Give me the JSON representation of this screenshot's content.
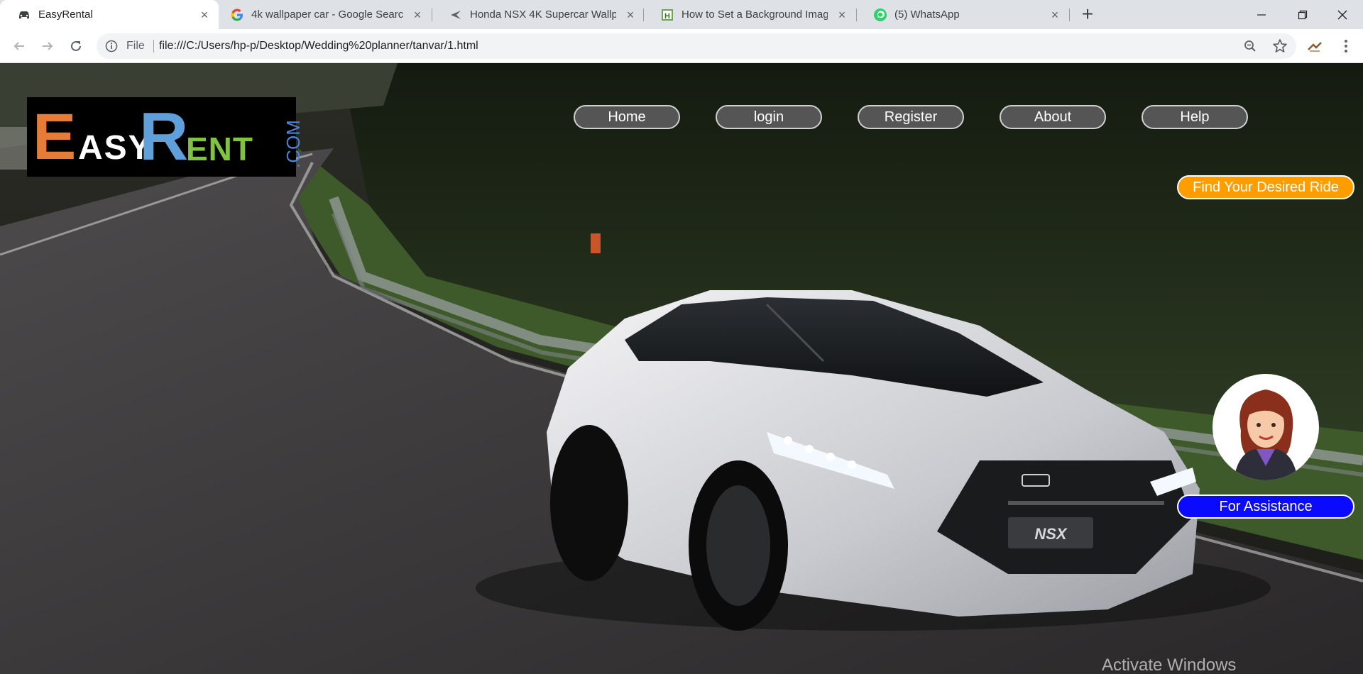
{
  "browser": {
    "tabs": [
      {
        "title": "EasyRental",
        "favicon": "car-icon",
        "active": true
      },
      {
        "title": "4k wallpaper car - Google Search",
        "favicon": "google-icon",
        "active": false
      },
      {
        "title": "Honda NSX 4K Supercar Wallpap",
        "favicon": "jet-icon",
        "active": false
      },
      {
        "title": "How to Set a Background Image",
        "favicon": "h-icon",
        "active": false
      },
      {
        "title": "(5) WhatsApp",
        "favicon": "whatsapp-icon",
        "active": false
      }
    ],
    "address": {
      "scheme_label": "File",
      "url": "file:///C:/Users/hp-p/Desktop/Wedding%20planner/tanvar/1.html"
    }
  },
  "page": {
    "logo": {
      "first_letter": "E",
      "part1": "ASY",
      "second_letter": "R",
      "part2": "ENT",
      "suffix": ".COM"
    },
    "nav": [
      {
        "label": "Home"
      },
      {
        "label": "login"
      },
      {
        "label": "Register"
      },
      {
        "label": "About"
      },
      {
        "label": "Help"
      }
    ],
    "cta_label": "Find Your Desired Ride",
    "assist_label": "For Assistance",
    "hero_plate_text": "NSX",
    "colors": {
      "nav_bg": "#555555",
      "cta_bg": "#ff9d00",
      "assist_bg": "#0a0aff",
      "logo_e": "#e57c37",
      "logo_r": "#5fa0da",
      "logo_ent": "#80c341"
    }
  },
  "os": {
    "watermark": "Activate Windows"
  }
}
